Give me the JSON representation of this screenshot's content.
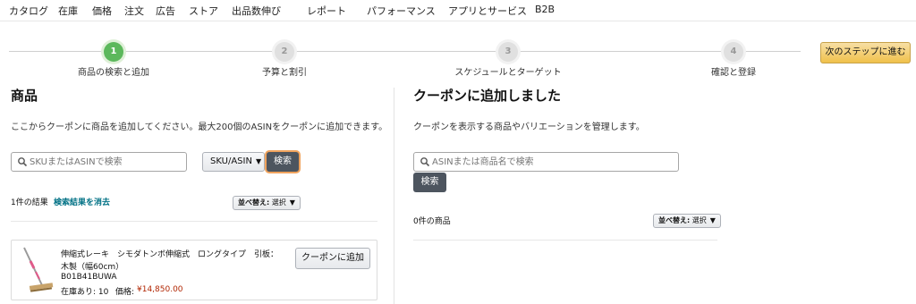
{
  "nav": {
    "items": [
      "カタログ",
      "在庫",
      "価格",
      "注文",
      "広告",
      "ストア",
      "出品数伸び",
      "レポート",
      "パフォーマンス",
      "アプリとサービス",
      "B2B"
    ]
  },
  "stepper": {
    "steps": [
      {
        "number": "1",
        "label": "商品の検索と追加",
        "state": "active"
      },
      {
        "number": "2",
        "label": "予算と割引",
        "state": "inactive"
      },
      {
        "number": "3",
        "label": "スケジュールとターゲット",
        "state": "inactive"
      },
      {
        "number": "4",
        "label": "確認と登録",
        "state": "inactive"
      }
    ],
    "next_label": "次のステップに進む"
  },
  "left": {
    "title": "商品",
    "description": "ここからクーポンに商品を追加してください。最大200個のASINをクーポンに追加できます。",
    "search_placeholder": "SKUまたはASINで検索",
    "search_type": "SKU/ASIN",
    "search_button": "検索",
    "result_count": "1件の結果",
    "clear_link": "検索結果を消去",
    "sort_label": "並べ替え:",
    "sort_value": "選択",
    "product": {
      "title_line1": "伸縮式レーキ　シモダトンボ伸縮式　ロングタイプ　引板：",
      "title_line2": "木製（幅60cm）",
      "asin": "B01B41BUWA",
      "stock": "在庫あり: 10",
      "price_label": "価格:",
      "price": "¥14,850.00",
      "add_button": "クーポンに追加"
    }
  },
  "right": {
    "title": "クーポンに追加しました",
    "description": "クーポンを表示する商品やバリエーションを管理します。",
    "search_placeholder": "ASINまたは商品名で検索",
    "search_button": "検索",
    "item_count": "0件の商品",
    "sort_label": "並べ替え:",
    "sort_value": "選択"
  },
  "colors": {
    "step_active": "#5cb85c",
    "next_button": "#f0c14b",
    "dark_button": "#4d555f",
    "link": "#007185",
    "price": "#b12704"
  }
}
